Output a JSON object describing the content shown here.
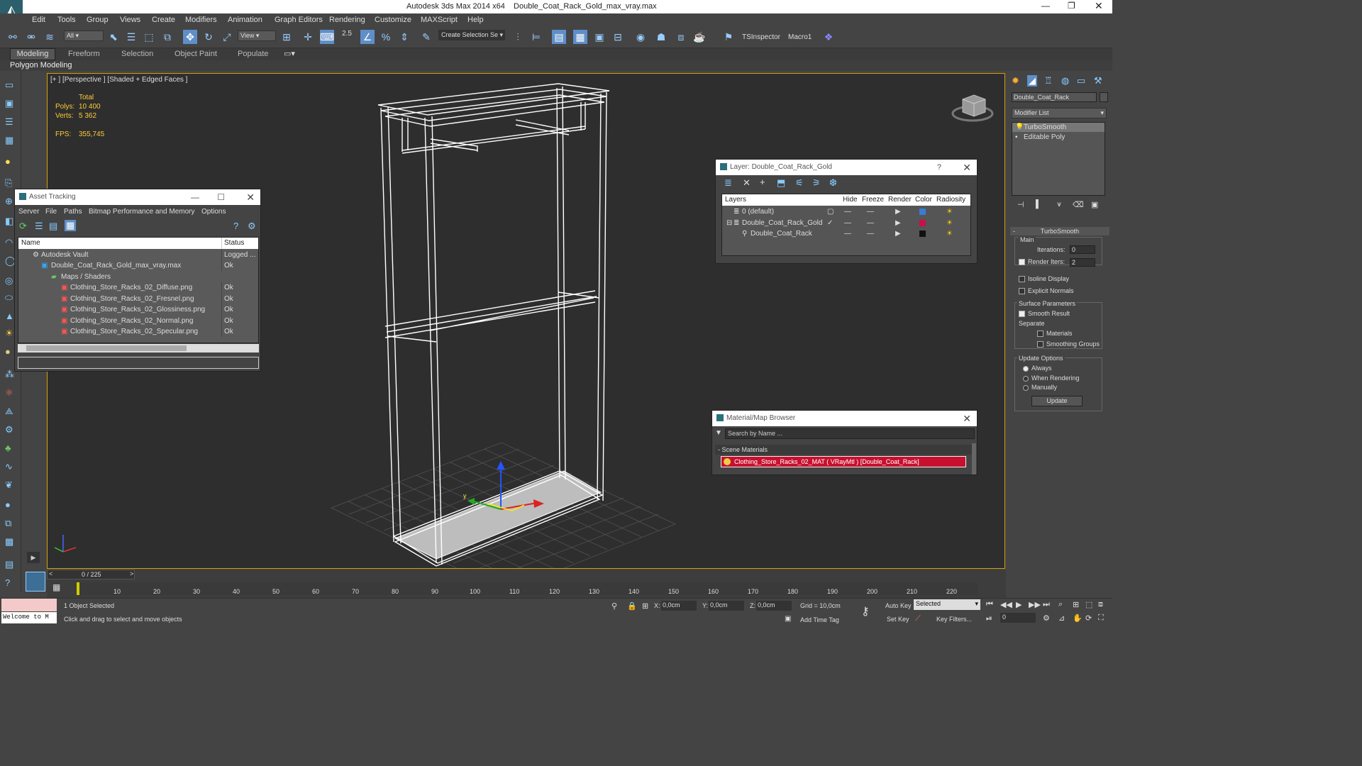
{
  "window": {
    "app": "Autodesk 3ds Max  2014 x64",
    "file": "Double_Coat_Rack_Gold_max_vray.max"
  },
  "menus": [
    "Edit",
    "Tools",
    "Group",
    "Views",
    "Create",
    "Modifiers",
    "Animation",
    "Graph Editors",
    "Rendering",
    "Customize",
    "MAXScript",
    "Help"
  ],
  "toolbar": {
    "filter": "All",
    "ref_coord": "View",
    "snap_value": "2.5",
    "selection_set": "Create Selection Se",
    "tsinspector": "TSInspector",
    "macro": "Macro1"
  },
  "ribbon": {
    "tabs": [
      "Modeling",
      "Freeform",
      "Selection",
      "Object Paint",
      "Populate"
    ],
    "sub": "Polygon Modeling"
  },
  "viewport": {
    "label": "[+ ] [Perspective ] [Shaded + Edged Faces ]",
    "stats": {
      "total": "Total",
      "polys_label": "Polys:",
      "polys": "10 400",
      "verts_label": "Verts:",
      "verts": "5 362",
      "fps_label": "FPS:",
      "fps": "355,745"
    },
    "axis_y": "y"
  },
  "asset_tracking": {
    "title": "Asset Tracking",
    "menus": [
      "Server",
      "File",
      "Paths",
      "Bitmap Performance and Memory",
      "Options"
    ],
    "col_name": "Name",
    "col_status": "Status",
    "rows": [
      {
        "name": "Autodesk Vault",
        "status": "Logged ..."
      },
      {
        "name": "Double_Coat_Rack_Gold_max_vray.max",
        "status": "Ok"
      },
      {
        "name": "Maps / Shaders",
        "status": ""
      },
      {
        "name": "Clothing_Store_Racks_02_Diffuse.png",
        "status": "Ok"
      },
      {
        "name": "Clothing_Store_Racks_02_Fresnel.png",
        "status": "Ok"
      },
      {
        "name": "Clothing_Store_Racks_02_Glossiness.png",
        "status": "Ok"
      },
      {
        "name": "Clothing_Store_Racks_02_Normal.png",
        "status": "Ok"
      },
      {
        "name": "Clothing_Store_Racks_02_Specular.png",
        "status": "Ok"
      }
    ]
  },
  "layer_window": {
    "title": "Layer: Double_Coat_Rack_Gold",
    "help": "?",
    "cols": [
      "Layers",
      "Hide",
      "Freeze",
      "Render",
      "Color",
      "Radiosity"
    ],
    "rows": [
      {
        "name": "0 (default)",
        "color": "#3a7bd5"
      },
      {
        "name": "Double_Coat_Rack_Gold",
        "color": "#c8104a"
      },
      {
        "name": "Double_Coat_Rack",
        "color": "#111111"
      }
    ]
  },
  "material_browser": {
    "title": "Material/Map Browser",
    "search_placeholder": "Search by Name ...",
    "section": "- Scene Materials",
    "item": "Clothing_Store_Racks_02_MAT  ( VRayMtl ) [Double_Coat_Rack]"
  },
  "command_panel": {
    "object_name": "Double_Coat_Rack",
    "modifier_list": "Modifier List",
    "stack": [
      "TurboSmooth",
      "Editable Poly"
    ],
    "rollout_title": "TurboSmooth",
    "main": "Main",
    "iterations_label": "Iterations:",
    "iterations": "0",
    "render_iters_label": "Render Iters:",
    "render_iters": "2",
    "isoline": "Isoline Display",
    "explicit_normals": "Explicit Normals",
    "surface_params": "Surface Parameters",
    "smooth_result": "Smooth Result",
    "separate": "Separate",
    "materials": "Materials",
    "smoothing_groups": "Smoothing Groups",
    "update_options": "Update Options",
    "always": "Always",
    "when_rendering": "When Rendering",
    "manually": "Manually",
    "update": "Update"
  },
  "timeline": {
    "frame": "0 / 225",
    "ticks": [
      "10",
      "20",
      "30",
      "40",
      "50",
      "60",
      "70",
      "80",
      "90",
      "100",
      "110",
      "120",
      "130",
      "140",
      "150",
      "160",
      "170",
      "180",
      "190",
      "200",
      "210",
      "220"
    ]
  },
  "status": {
    "listener": "Welcome to M",
    "selected": "1 Object Selected",
    "hint": "Click and drag to select and move objects",
    "x_label": "X:",
    "x": "0,0cm",
    "y_label": "Y:",
    "y": "0,0cm",
    "z_label": "Z:",
    "z": "0,0cm",
    "grid": "Grid = 10,0cm",
    "add_time_tag": "Add Time Tag",
    "auto_key": "Auto Key",
    "set_key": "Set Key",
    "key_mode": "Selected",
    "key_filters": "Key Filters...",
    "frame_field": "0"
  }
}
